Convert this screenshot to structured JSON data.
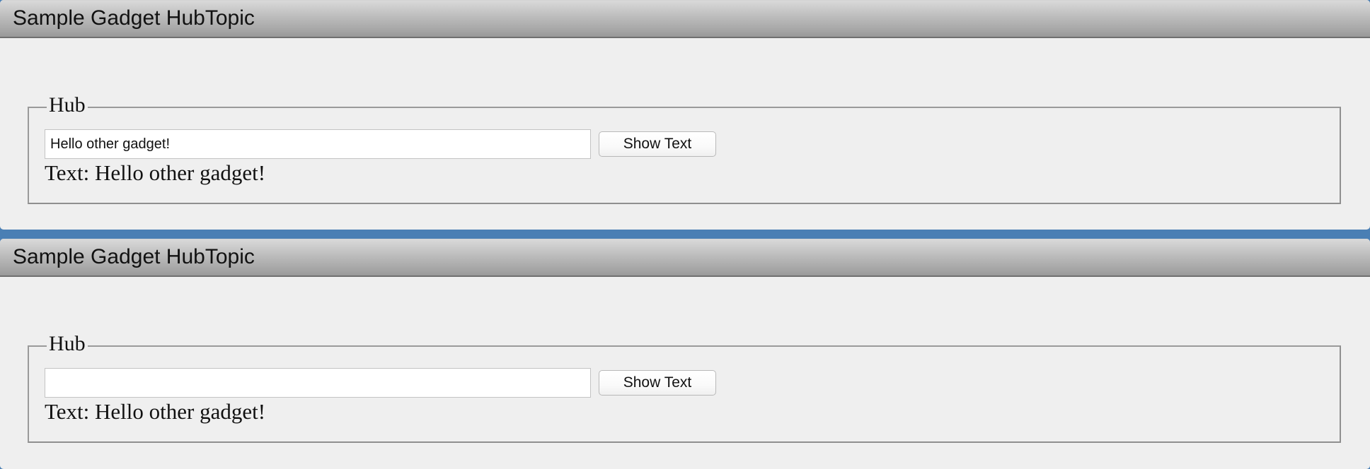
{
  "gadgets": [
    {
      "title": "Sample Gadget HubTopic",
      "hub": {
        "legend": "Hub",
        "input_value": "Hello other gadget!",
        "input_placeholder": "",
        "button_label": "Show Text",
        "output_text": "Text: Hello other gadget!"
      }
    },
    {
      "title": "Sample Gadget HubTopic",
      "hub": {
        "legend": "Hub",
        "input_value": "",
        "input_placeholder": "",
        "button_label": "Show Text",
        "output_text": "Text: Hello other gadget!"
      }
    }
  ],
  "colors": {
    "background_accent": "#4a7fb4",
    "panel": "#efefef",
    "header_top": "#d9d9d9",
    "header_bottom": "#999999"
  }
}
